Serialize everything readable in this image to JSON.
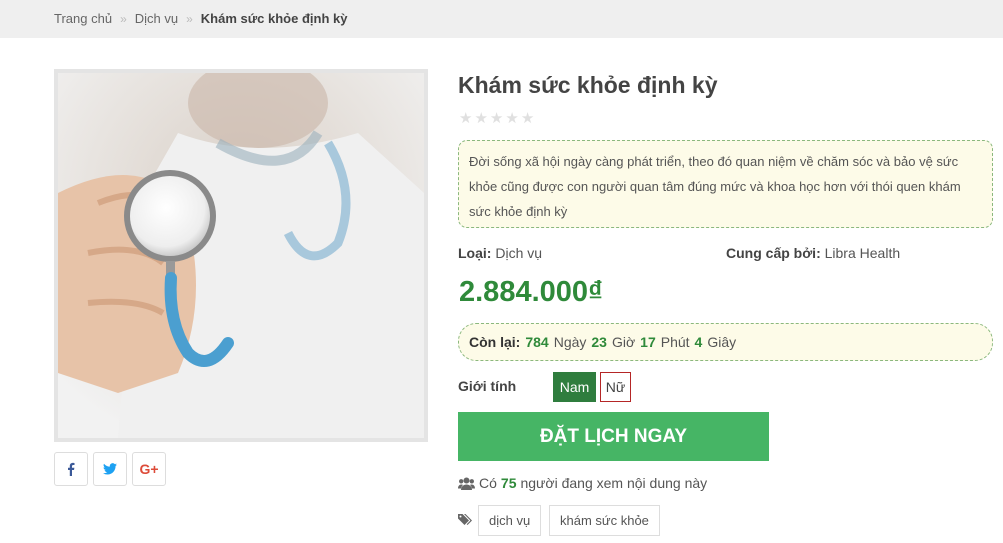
{
  "breadcrumb": {
    "home": "Trang chủ",
    "category": "Dịch vụ",
    "current": "Khám sức khỏe định kỳ"
  },
  "product": {
    "title": "Khám sức khỏe định kỳ",
    "rating": 0,
    "rating_max": 5,
    "summary": "Đời sống xã hội ngày càng phát triển, theo đó quan niệm về chăm sóc và bảo vệ sức khỏe cũng được con người quan tâm đúng mức và khoa học hơn với thói quen khám sức khỏe định kỳ",
    "type_label": "Loại:",
    "type_value": "Dịch vụ",
    "provider_label": "Cung cấp bởi:",
    "provider_value": "Libra Health",
    "price": "2.884.000₫"
  },
  "countdown": {
    "label": "Còn lại:",
    "days": "784",
    "days_unit": "Ngày",
    "hours": "23",
    "hours_unit": "Giờ",
    "minutes": "17",
    "minutes_unit": "Phút",
    "seconds": "4",
    "seconds_unit": "Giây"
  },
  "gender": {
    "label": "Giới tính",
    "options": [
      "Nam",
      "Nữ"
    ],
    "selected": "Nam"
  },
  "book_button": "ĐẶT LỊCH NGAY",
  "viewers": {
    "prefix": "Có",
    "count": "75",
    "suffix": "người đang xem nội dung này"
  },
  "tags": [
    "dịch vụ",
    "khám sức khỏe"
  ],
  "share": {
    "icons": [
      "facebook-icon",
      "twitter-icon",
      "google-plus-icon"
    ]
  },
  "colors": {
    "accent": "#2f8a3a",
    "button": "#46b565",
    "selected_gender": "#2f7d3e",
    "female_border": "#b52626"
  }
}
